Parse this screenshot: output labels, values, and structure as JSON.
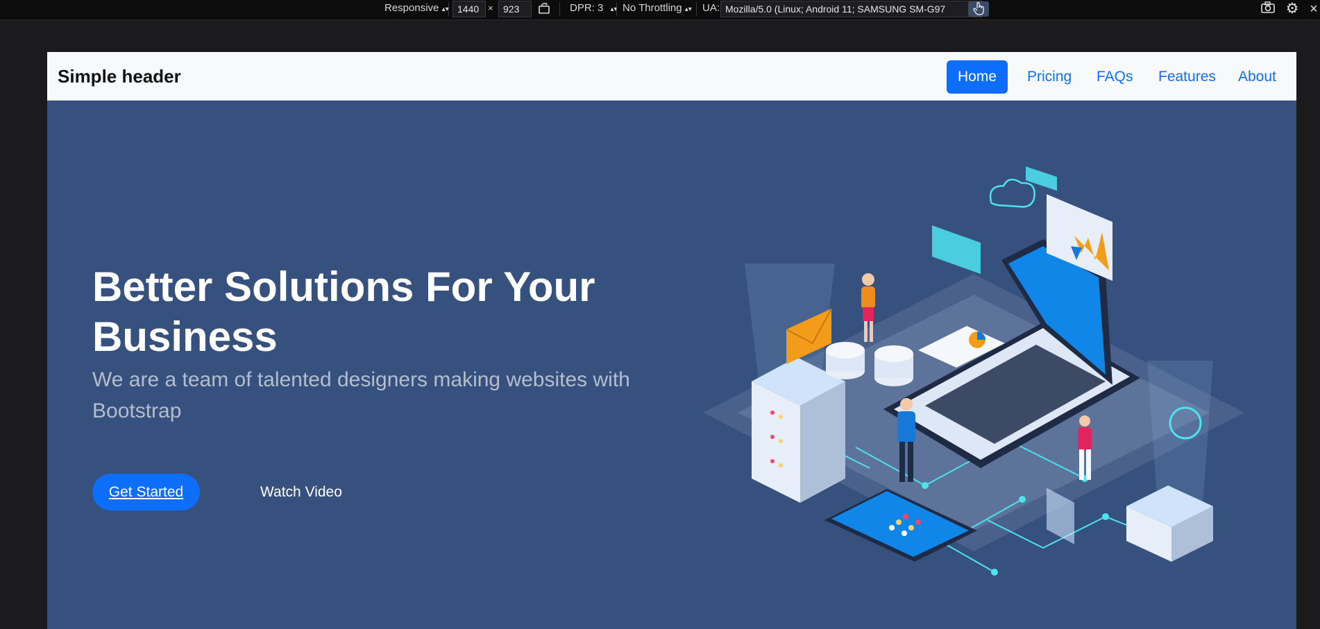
{
  "devtools": {
    "mode": "Responsive",
    "width": "1440",
    "times": "×",
    "height": "923",
    "dpr": "DPR: 3",
    "throttling": "No Throttling",
    "ua_label": "UA:",
    "ua_value": "Mozilla/5.0 (Linux; Android 11; SAMSUNG SM-G97",
    "icons": [
      "rotate-icon",
      "touch-icon",
      "camera-icon",
      "gear-icon",
      "close-icon"
    ]
  },
  "header": {
    "brand": "Simple header",
    "nav": [
      {
        "label": "Home",
        "active": true
      },
      {
        "label": "Pricing",
        "active": false
      },
      {
        "label": "FAQs",
        "active": false
      },
      {
        "label": "Features",
        "active": false
      },
      {
        "label": "About",
        "active": false
      }
    ]
  },
  "hero": {
    "title_line1": "Better Solutions For Your",
    "title_line2": "Business",
    "subtitle_line1": "We are a team of talented designers making websites with",
    "subtitle_line2": "Bootstrap",
    "primary_cta": "Get Started",
    "secondary_cta": "Watch Video"
  },
  "colors": {
    "hero_bg": "#37517e",
    "primary": "#0d6efd",
    "navbar_bg": "#f8f9fa",
    "devtools_bg": "#0c0c0d"
  }
}
